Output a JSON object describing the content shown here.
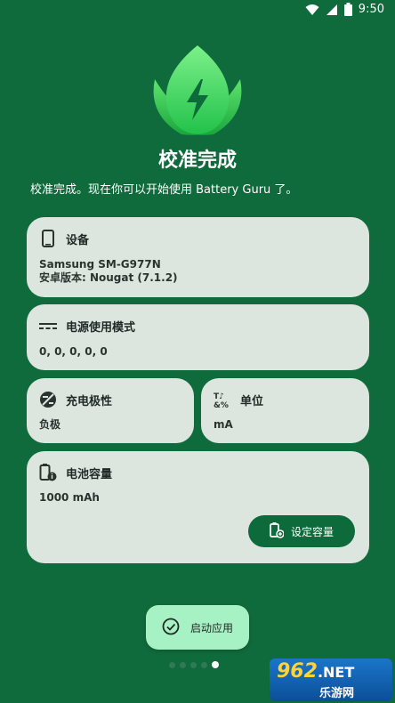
{
  "status_bar": {
    "time": "9:50"
  },
  "header": {
    "title": "校准完成",
    "subtitle": "校准完成。现在你可以开始使用 Battery Guru 了。"
  },
  "cards": {
    "device": {
      "label": "设备",
      "model": "Samsung SM-G977N",
      "android": "安卓版本: Nougat (7.1.2)"
    },
    "power_mode": {
      "label": "电源使用模式",
      "value": "0, 0, 0, 0, 0"
    },
    "polarity": {
      "label": "充电极性",
      "value": "负极"
    },
    "unit": {
      "label": "单位",
      "value": "mA"
    },
    "capacity": {
      "label": "电池容量",
      "value": "1000 mAh",
      "button": "设定容量"
    }
  },
  "launch_button": {
    "label": "启动应用"
  },
  "pager": {
    "count": 5,
    "active": 5
  },
  "watermark": {
    "top": "962",
    "net": ".NET",
    "bottom": "乐游网"
  },
  "colors": {
    "background": "#0f6a3c",
    "card": "#dde5df",
    "accent": "#0d6a3a",
    "launch": "#a6f2c4"
  }
}
